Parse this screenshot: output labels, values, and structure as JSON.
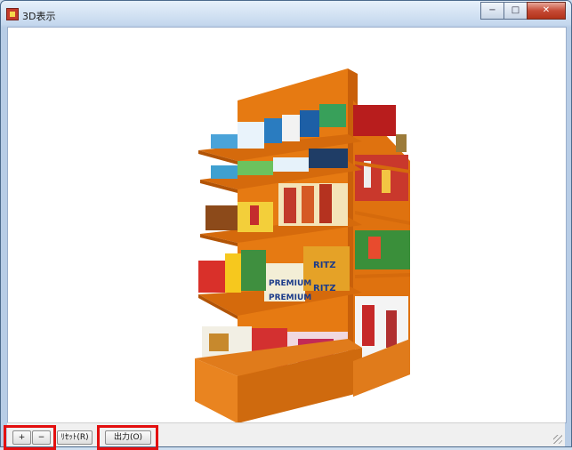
{
  "window": {
    "title": "3D表示",
    "minimize_label": "−",
    "maximize_label": "□",
    "close_label": "✕"
  },
  "toolbar": {
    "zoom_in_label": "+",
    "zoom_out_label": "−",
    "reset_label": "ﾘｾｯﾄ(R)",
    "output_label": "出力(O)"
  },
  "colors": {
    "shelf_orange": "#ea7d12",
    "highlight_red": "#e30f0f"
  },
  "scene": {
    "products": [
      {
        "name": "PREMIUM"
      },
      {
        "name": "RITZ"
      },
      {
        "name": "PREMIUM"
      },
      {
        "name": "RITZ"
      }
    ]
  }
}
